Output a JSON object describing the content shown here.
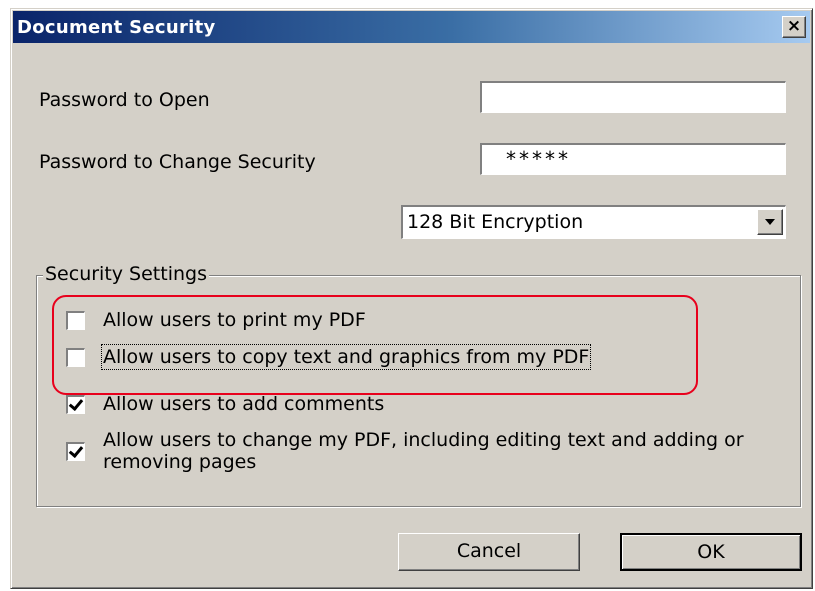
{
  "window": {
    "title": "Document Security",
    "close_glyph": "×"
  },
  "fields": {
    "password_open_label": "Password to Open",
    "password_open_value": "",
    "password_change_label": "Password to Change Security",
    "password_change_value": "*****",
    "encryption_selected": "128 Bit Encryption"
  },
  "security_settings": {
    "group_label": "Security Settings",
    "options": [
      {
        "label": "Allow users to print my PDF",
        "checked": false
      },
      {
        "label": "Allow users to copy text and graphics from my PDF",
        "checked": false
      },
      {
        "label": "Allow users to add comments",
        "checked": true
      },
      {
        "label": "Allow users to change my PDF, including editing text and adding or removing pages",
        "checked": true
      }
    ]
  },
  "buttons": {
    "cancel_label": "Cancel",
    "ok_label": "OK"
  },
  "colors": {
    "titlebar_start": "#0a246a",
    "titlebar_end": "#a6caf0",
    "dialog_face": "#d4d0c8",
    "highlight": "#e8001c"
  },
  "icons": {
    "close": "close-icon",
    "dropdown": "chevron-down-icon",
    "check": "checkmark-icon"
  }
}
